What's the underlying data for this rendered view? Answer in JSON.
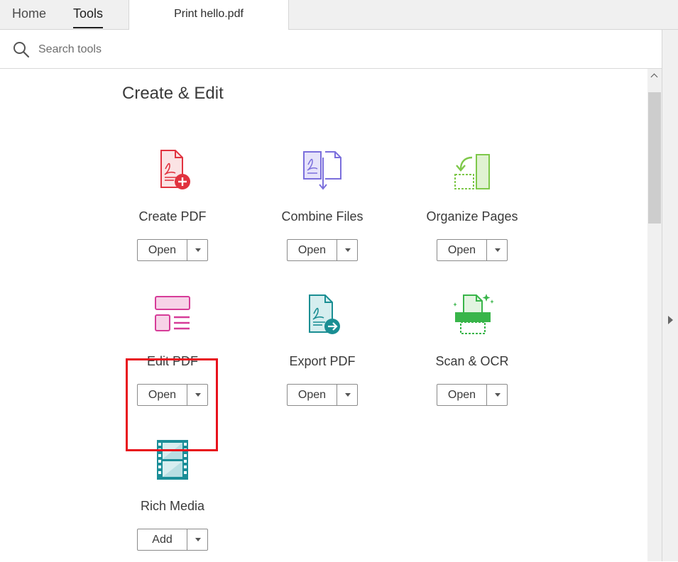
{
  "nav": {
    "home": "Home",
    "tools": "Tools",
    "document_tab": "Print hello.pdf"
  },
  "search": {
    "placeholder": "Search tools",
    "icon": "search-icon"
  },
  "section": {
    "title": "Create & Edit"
  },
  "tools": [
    {
      "label": "Create PDF",
      "button": "Open",
      "icon": "create-pdf-icon",
      "color": "#e1333f"
    },
    {
      "label": "Combine Files",
      "button": "Open",
      "icon": "combine-files-icon",
      "color": "#7b6fdc"
    },
    {
      "label": "Organize Pages",
      "button": "Open",
      "icon": "organize-pages-icon",
      "color": "#7ec84a"
    },
    {
      "label": "Edit PDF",
      "button": "Open",
      "icon": "edit-pdf-icon",
      "color": "#d63c98"
    },
    {
      "label": "Export PDF",
      "button": "Open",
      "icon": "export-pdf-icon",
      "color": "#1a8e93"
    },
    {
      "label": "Scan & OCR",
      "button": "Open",
      "icon": "scan-ocr-icon",
      "color": "#39b54a"
    },
    {
      "label": "Rich Media",
      "button": "Add",
      "icon": "rich-media-icon",
      "color": "#1b8e98"
    }
  ],
  "colors": {
    "highlight": "#e8121c"
  }
}
